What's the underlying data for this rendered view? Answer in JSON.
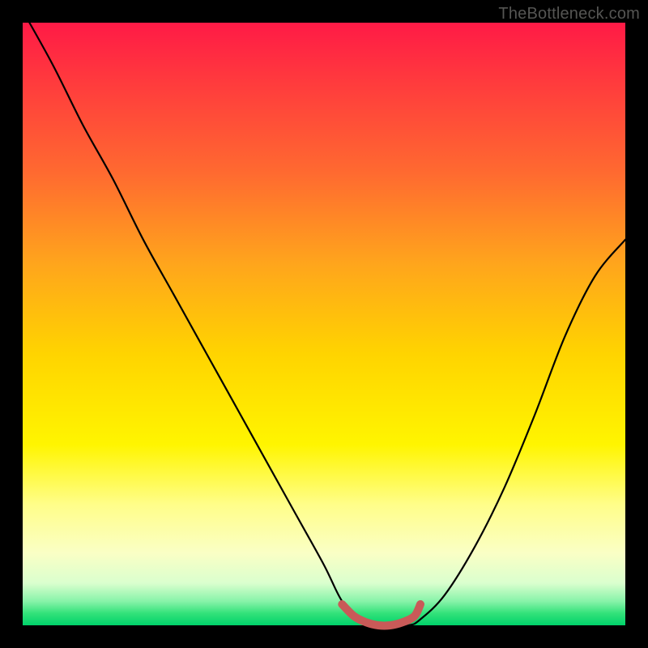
{
  "watermark": "TheBottleneck.com",
  "colors": {
    "background": "#000000",
    "curve_stroke": "#000000",
    "marker_stroke": "#c95a58",
    "gradient_top": "#ff1a46",
    "gradient_bottom": "#00d26a"
  },
  "chart_data": {
    "type": "line",
    "title": "",
    "xlabel": "",
    "ylabel": "",
    "xlim": [
      0,
      1
    ],
    "ylim": [
      0,
      1
    ],
    "series": [
      {
        "name": "curve",
        "x": [
          0.0,
          0.05,
          0.1,
          0.15,
          0.2,
          0.25,
          0.3,
          0.35,
          0.4,
          0.45,
          0.5,
          0.53,
          0.56,
          0.6,
          0.64,
          0.66,
          0.7,
          0.75,
          0.8,
          0.85,
          0.9,
          0.95,
          1.0
        ],
        "values": [
          1.02,
          0.93,
          0.83,
          0.74,
          0.64,
          0.55,
          0.46,
          0.37,
          0.28,
          0.19,
          0.1,
          0.04,
          0.01,
          0.0,
          0.0,
          0.01,
          0.05,
          0.13,
          0.23,
          0.35,
          0.48,
          0.58,
          0.64
        ]
      },
      {
        "name": "valley-marker",
        "x": [
          0.53,
          0.55,
          0.57,
          0.59,
          0.61,
          0.63,
          0.65,
          0.66
        ],
        "values": [
          0.035,
          0.015,
          0.005,
          0.0,
          0.0,
          0.005,
          0.015,
          0.035
        ]
      }
    ]
  }
}
